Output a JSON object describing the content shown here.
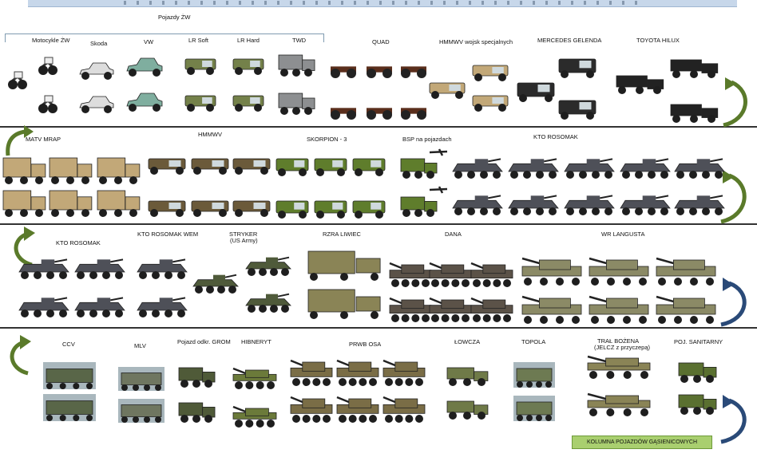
{
  "colors": {
    "camo_olive": "#6b7a3a",
    "camo_tan": "#c2a878",
    "gray_armor": "#4e5058",
    "green_armor": "#5f7d2c",
    "arrow_green": "#5a7a2a",
    "arrow_blue": "#2a4a78",
    "banner_green": "#a9cf6f"
  },
  "row1": {
    "group_label": "Pojazdy ŻW",
    "labels": [
      "Motocykle ŻW",
      "Skoda",
      "VW",
      "LR Soft",
      "LR Hard",
      "TWD",
      "QUAD",
      "HMMWV wojsk specjalnych",
      "MERCEDES GELENDA",
      "TOYOTA HILUX"
    ]
  },
  "row2": {
    "labels": [
      "MATV MRAP",
      "HMMWV",
      "SKORPION - 3",
      "BSP na pojazdach",
      "KTO ROSOMAK"
    ]
  },
  "row3": {
    "labels": [
      "KTO ROSOMAK",
      "KTO ROSOMAK WEM",
      "STRYKER",
      "(US Army)",
      "RZRA LIWIEC",
      "DANA",
      "WR LANGUSTA"
    ]
  },
  "row4": {
    "labels": [
      "CCV",
      "MLV",
      "Pojazd odkr. GROM",
      "HIBNERYT",
      "PRWB OSA",
      "ŁOWCZA",
      "TOPOLA",
      "TRAŁ BOŻENA",
      "(JELCZ z przyczepą)",
      "POJ. SANITARNY"
    ],
    "banner": "KOLUMNA POJAZDÓW GĄSIENICOWYCH"
  }
}
